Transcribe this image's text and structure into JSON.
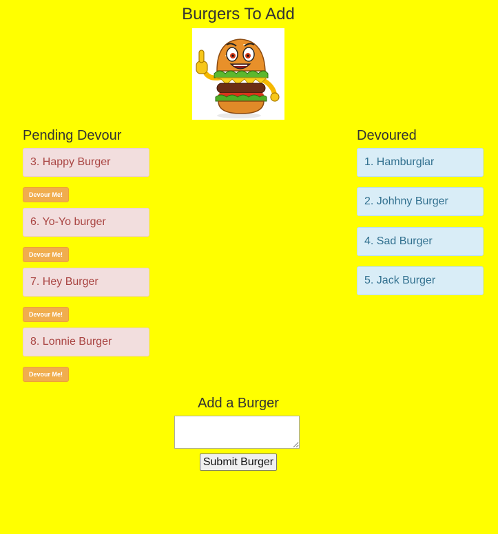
{
  "header": {
    "title": "Burgers To Add",
    "logo": "cartoon-burger-mascot"
  },
  "pending": {
    "title": "Pending Devour",
    "items": [
      {
        "label": "3. Happy Burger",
        "button": "Devour Me!"
      },
      {
        "label": "6. Yo-Yo burger",
        "button": "Devour Me!"
      },
      {
        "label": "7. Hey Burger",
        "button": "Devour Me!"
      },
      {
        "label": "8. Lonnie Burger",
        "button": "Devour Me!"
      }
    ]
  },
  "devoured": {
    "title": "Devoured",
    "items": [
      {
        "label": "1. Hamburglar"
      },
      {
        "label": "2. Johhny Burger"
      },
      {
        "label": "4. Sad Burger"
      },
      {
        "label": "5. Jack Burger"
      }
    ]
  },
  "form": {
    "title": "Add a Burger",
    "input_value": "",
    "submit_label": "Submit Burger"
  },
  "colors": {
    "background": "#ffff00",
    "pending_bg": "#f2dede",
    "pending_text": "#a94442",
    "devoured_bg": "#d9edf7",
    "devoured_text": "#31708f",
    "devour_button": "#f0ad4e"
  }
}
